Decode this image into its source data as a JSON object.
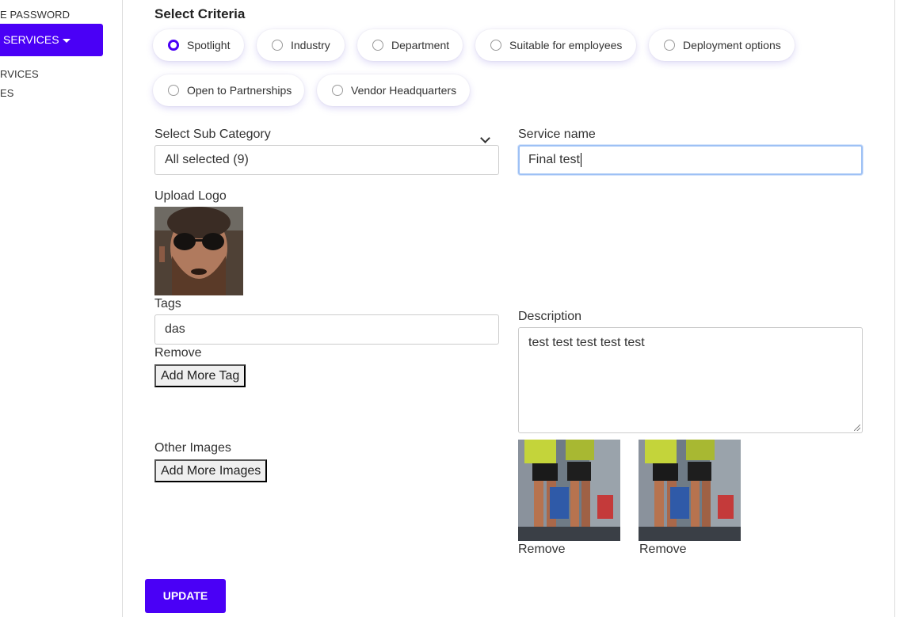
{
  "sidebar": {
    "items": [
      {
        "label": "E PASSWORD"
      },
      {
        "label": "SERVICES",
        "active": true
      },
      {
        "label": "RVICES"
      },
      {
        "label": "ES"
      }
    ]
  },
  "criteria": {
    "title": "Select Criteria",
    "options": [
      {
        "label": "Spotlight",
        "checked": true
      },
      {
        "label": "Industry",
        "checked": false
      },
      {
        "label": "Department",
        "checked": false
      },
      {
        "label": "Suitable for employees",
        "checked": false
      },
      {
        "label": "Deployment options",
        "checked": false
      },
      {
        "label": "Open to Partnerships",
        "checked": false
      },
      {
        "label": "Vendor Headquarters",
        "checked": false
      }
    ]
  },
  "form": {
    "sub_category": {
      "label": "Select Sub Category",
      "value": "All selected (9)"
    },
    "service_name": {
      "label": "Service name",
      "value": "Final test"
    },
    "upload_logo": {
      "label": "Upload Logo"
    },
    "tags": {
      "label": "Tags",
      "value": "das",
      "remove_label": "Remove",
      "add_button": "Add More Tag"
    },
    "description": {
      "label": "Description",
      "value": "test test test test test"
    },
    "other_images": {
      "label": "Other Images",
      "add_button": "Add More Images",
      "remove_label_1": "Remove",
      "remove_label_2": "Remove"
    },
    "update_button": "UPDATE"
  },
  "colors": {
    "accent": "#4a00f6",
    "focus_border": "#9ec1f5"
  }
}
